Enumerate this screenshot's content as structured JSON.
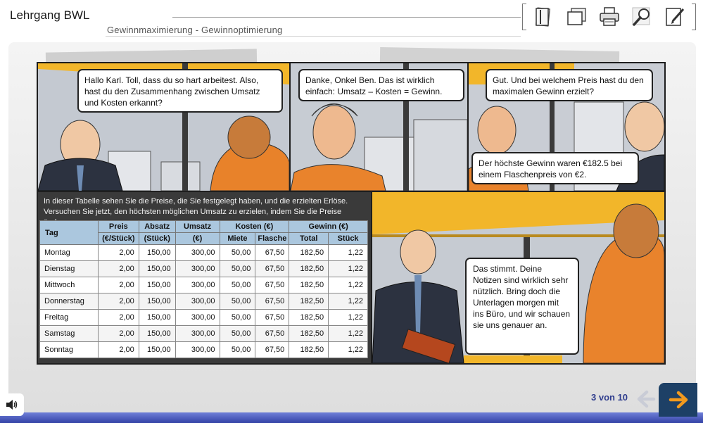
{
  "header": {
    "app_title": "Lehrgang BWL",
    "subtitle": "Gewinnmaximierung - Gewinnoptimierung"
  },
  "toolbar": {
    "icons": [
      "notes-icon",
      "pages-icon",
      "print-icon",
      "search-icon",
      "edit-icon"
    ]
  },
  "comic": {
    "bubbles": [
      "Hallo Karl. Toll, dass du so hart arbeitest. Also, hast du den Zusammenhang zwischen Umsatz und Kosten erkannt?",
      "Danke, Onkel Ben. Das ist wirklich einfach: Umsatz – Kosten = Gewinn.",
      "Gut. Und bei welchem Preis hast du den maximalen Gewinn erzielt?",
      "Der höchste Gewinn waren €182.5 bei einem Flaschenpreis von €2.",
      "Das stimmt. Deine Notizen sind wirklich sehr nützlich. Bring doch die Unterlagen morgen mit ins Büro, und wir schauen sie uns genauer an."
    ]
  },
  "table": {
    "intro": "In dieser Tabelle sehen Sie die Preise, die Sie festgelegt haben, und die erzielten Erlöse. Versuchen Sie jetzt, den höchsten möglichen Umsatz zu erzielen, indem Sie die Preise ändern.",
    "headers": {
      "tag": "Tag",
      "preis": "Preis",
      "preis_unit": "(€/Stück)",
      "absatz": "Absatz",
      "absatz_unit": "(Stück)",
      "umsatz": "Umsatz",
      "umsatz_unit": "(€)",
      "kosten": "Kosten (€)",
      "gewinn": "Gewinn (€)",
      "miete": "Miete",
      "flasche": "Flasche",
      "total": "Total",
      "stueck": "Stück"
    },
    "rows": [
      [
        "Montag",
        "2,00",
        "150,00",
        "300,00",
        "50,00",
        "67,50",
        "182,50",
        "1,22"
      ],
      [
        "Dienstag",
        "2,00",
        "150,00",
        "300,00",
        "50,00",
        "67,50",
        "182,50",
        "1,22"
      ],
      [
        "Mittwoch",
        "2,00",
        "150,00",
        "300,00",
        "50,00",
        "67,50",
        "182,50",
        "1,22"
      ],
      [
        "Donnerstag",
        "2,00",
        "150,00",
        "300,00",
        "50,00",
        "67,50",
        "182,50",
        "1,22"
      ],
      [
        "Freitag",
        "2,00",
        "150,00",
        "300,00",
        "50,00",
        "67,50",
        "182,50",
        "1,22"
      ],
      [
        "Samstag",
        "2,00",
        "150,00",
        "300,00",
        "50,00",
        "67,50",
        "182,50",
        "1,22"
      ],
      [
        "Sonntag",
        "2,00",
        "150,00",
        "300,00",
        "50,00",
        "67,50",
        "182,50",
        "1,22"
      ]
    ]
  },
  "footer": {
    "page_counter": "3 von 10",
    "sound_icon": "speaker-icon",
    "prev_icon": "arrow-left-icon",
    "next_icon": "arrow-right-icon"
  },
  "colors": {
    "accent_orange": "#f39a1e",
    "navy": "#1d4066",
    "table_header": "#abc7de",
    "page_counter": "#2f3d8d"
  }
}
